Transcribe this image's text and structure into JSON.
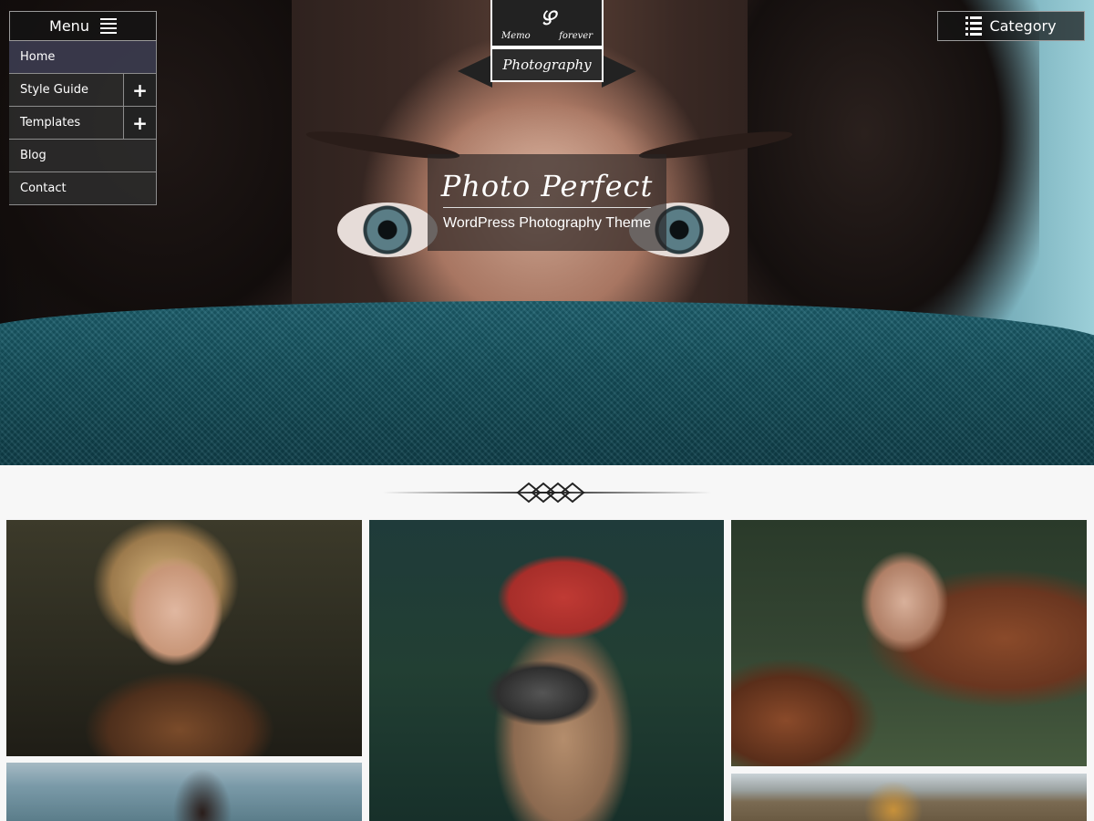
{
  "menu": {
    "title": "Menu",
    "items": [
      {
        "label": "Home"
      },
      {
        "label": "Style Guide"
      },
      {
        "label": "Templates"
      },
      {
        "label": "Blog"
      },
      {
        "label": "Contact"
      }
    ],
    "expand_symbol": "+"
  },
  "category": {
    "label": "Category"
  },
  "logo": {
    "top_left": "Memo",
    "top_right": "forever",
    "ribbon": "Photography",
    "swirl": "ഴ"
  },
  "hero": {
    "title": "Photo Perfect",
    "subtitle": "WordPress Photography Theme"
  },
  "colors": {
    "accent": "#14505c",
    "overlay": "#282323"
  }
}
